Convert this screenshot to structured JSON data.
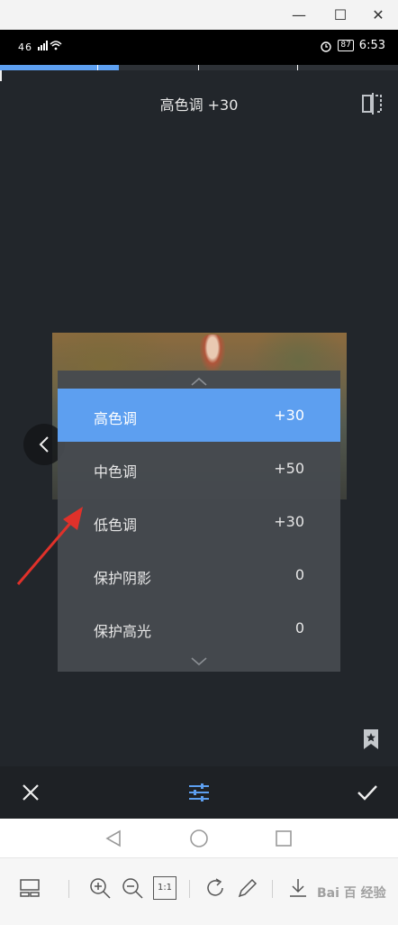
{
  "window": {
    "minimize_glyph": "—",
    "maximize_glyph": "☐",
    "close_glyph": "✕"
  },
  "status_bar": {
    "network": "46",
    "battery": "87",
    "time": "6:53"
  },
  "progress": {
    "accent": "#5d9ff0",
    "segments": [
      {
        "state": "active"
      },
      {
        "state": "inactive"
      },
      {
        "state": "inactive"
      },
      {
        "state": "inactive"
      }
    ]
  },
  "header": {
    "title": "高色调 +30"
  },
  "adjust_panel": {
    "items": [
      {
        "label": "高色调",
        "value": "+30",
        "selected": true
      },
      {
        "label": "中色调",
        "value": "+50",
        "selected": false
      },
      {
        "label": "低色调",
        "value": "+30",
        "selected": false
      },
      {
        "label": "保护阴影",
        "value": "0",
        "selected": false
      },
      {
        "label": "保护高光",
        "value": "0",
        "selected": false
      }
    ]
  },
  "bottom_toolbar": {
    "icons": [
      "close-icon",
      "tune-icon",
      "check-icon"
    ],
    "accent": "#5d9ff0"
  },
  "nav_bar": {
    "icons": [
      "back-triangle-icon",
      "home-circle-icon",
      "recents-square-icon"
    ]
  },
  "emulator_tools": {
    "icons": [
      "layout-icon",
      "zoom-in-icon",
      "zoom-out-icon",
      "actual-size-icon",
      "rotate-icon",
      "edit-icon",
      "download-icon"
    ],
    "actual_size_label": "1:1",
    "watermark": "Bai 百 经验"
  }
}
